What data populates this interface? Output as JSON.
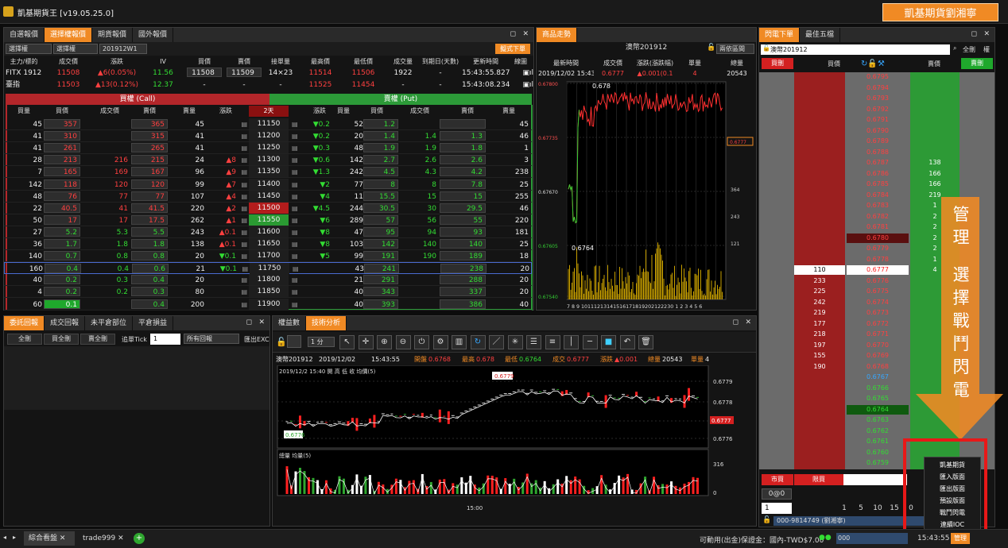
{
  "window": {
    "title": "凱基期貨王 [v19.05.25.0]",
    "brand": "凱基期貨劉湘寧"
  },
  "quote_panel": {
    "tabs": [
      "自選報價",
      "選擇權報價",
      "期貨報價",
      "國外報價"
    ],
    "selects": [
      "選擇權",
      "選擇權",
      "201912W1"
    ],
    "trad_button": "擬式下單",
    "header": [
      "主力/標的",
      "成交價",
      "漲跌",
      "IV",
      "買價",
      "賣價",
      "接單量",
      "最高價",
      "最低價",
      "成交量",
      "到期日(天數)",
      "更新時間",
      "線圖"
    ],
    "underlying": [
      [
        "FITX 1912",
        "11508",
        "▲6(0.05%)",
        "11.56",
        "11508",
        "11509",
        "14×23",
        "11514",
        "11506",
        "1922",
        "-",
        "15:43:55.827"
      ],
      [
        "臺指",
        "11503",
        "▲13(0.12%)",
        "12.37",
        "-",
        "-",
        "-",
        "11525",
        "11454",
        "-",
        "-",
        "15:43:08.234"
      ]
    ],
    "call_label": "買權 (Call)",
    "put_label": "賣權 (Put)",
    "days_label": "2天",
    "chain_header": [
      "買量",
      "買價",
      "成交價",
      "賣價",
      "賣量",
      "漲跌",
      "",
      "履約價",
      "",
      "漲跌",
      "買量",
      "買價",
      "成交價",
      "賣價",
      "賣量"
    ],
    "rows": [
      [
        "45",
        "357",
        "",
        "365",
        "45",
        "",
        "11150",
        "▼0.2",
        "52",
        "1.2",
        "",
        "",
        "45"
      ],
      [
        "41",
        "310",
        "",
        "315",
        "41",
        "",
        "11200",
        "▼0.2",
        "20",
        "1.4",
        "1.4",
        "1.3",
        "46"
      ],
      [
        "41",
        "261",
        "",
        "265",
        "41",
        "",
        "11250",
        "▼0.3",
        "48",
        "1.9",
        "1.9",
        "1.8",
        "1"
      ],
      [
        "28",
        "213",
        "216",
        "215",
        "24",
        "▲8",
        "11300",
        "▼0.6",
        "142",
        "2.7",
        "2.6",
        "2.6",
        "3"
      ],
      [
        "7",
        "165",
        "169",
        "167",
        "96",
        "▲9",
        "11350",
        "▼1.3",
        "242",
        "4.5",
        "4.3",
        "4.2",
        "238"
      ],
      [
        "142",
        "118",
        "120",
        "120",
        "99",
        "▲7",
        "11400",
        "▼2",
        "77",
        "8",
        "8",
        "7.8",
        "25"
      ],
      [
        "48",
        "76",
        "77",
        "77",
        "107",
        "▲4",
        "11450",
        "▼4",
        "11",
        "15.5",
        "15",
        "15",
        "255"
      ],
      [
        "22",
        "40.5",
        "41",
        "41.5",
        "220",
        "▲2",
        "11500",
        "▼4.5",
        "244",
        "30.5",
        "30",
        "29.5",
        "46"
      ],
      [
        "50",
        "17",
        "17",
        "17.5",
        "262",
        "▲1",
        "11550",
        "▼6",
        "289",
        "57",
        "56",
        "55",
        "220"
      ],
      [
        "27",
        "5.2",
        "5.3",
        "5.5",
        "243",
        "▲0.1",
        "11600",
        "▼8",
        "47",
        "95",
        "94",
        "93",
        "181"
      ],
      [
        "36",
        "1.7",
        "1.8",
        "1.8",
        "138",
        "▲0.1",
        "11650",
        "▼8",
        "103",
        "142",
        "140",
        "140",
        "25"
      ],
      [
        "140",
        "0.7",
        "0.8",
        "0.8",
        "20",
        "▼0.1",
        "11700",
        "▼5",
        "99",
        "191",
        "190",
        "189",
        "18"
      ],
      [
        "160",
        "0.4",
        "0.4",
        "0.6",
        "21",
        "▼0.1",
        "11750",
        "",
        "43",
        "241",
        "",
        "238",
        "20"
      ],
      [
        "40",
        "0.2",
        "0.3",
        "0.4",
        "20",
        "",
        "11800",
        "",
        "21",
        "291",
        "",
        "288",
        "20"
      ],
      [
        "4",
        "0.2",
        "0.2",
        "0.3",
        "80",
        "",
        "11850",
        "",
        "40",
        "343",
        "",
        "337",
        "20"
      ],
      [
        "60",
        "0.1",
        "",
        "0.4",
        "200",
        "",
        "11900",
        "",
        "40",
        "393",
        "",
        "386",
        "40"
      ]
    ]
  },
  "trend_panel": {
    "tab": "商品走勢",
    "symbol": "澳幣201912",
    "preset": "兩依區間",
    "header": [
      "最新時間",
      "成交價",
      "漲跌(漲跌幅)",
      "單量",
      "總量"
    ],
    "values": [
      "2019/12/02 15:43:",
      "0.6777",
      "▲0.001(0.1",
      "4",
      "20543"
    ],
    "high_label": "0.678",
    "low_label": "0.6764",
    "y_ticks": [
      "0.67800",
      "0.67735",
      "0.67670",
      "0.67605",
      "0.67540"
    ],
    "right_ticks": [
      "364",
      "243",
      "121"
    ],
    "last_tag": "0.6777",
    "x_ticks": "7 8 9 10111213141516171819202122230 1 2 3 4 5 6"
  },
  "order_panel": {
    "tabs": [
      "閃電下單",
      "最佳五檔"
    ],
    "symbol": "澳幣201912",
    "all_cancel": "全刪",
    "mode": "權",
    "buy_btn": "買刪",
    "sell_btn": "賣刪",
    "buy_header": "買價",
    "sell_header": "賣價",
    "prices": [
      "0.6795",
      "0.6794",
      "0.6793",
      "0.6792",
      "0.6791",
      "0.6790",
      "0.6789",
      "0.6788",
      "0.6787",
      "0.6786",
      "0.6785",
      "0.6784",
      "0.6783",
      "0.6782",
      "0.6781",
      "0.6780",
      "0.6779",
      "0.6778",
      "0.6777",
      "0.6776",
      "0.6775",
      "0.6774",
      "0.6773",
      "0.6772",
      "0.6771",
      "0.6770",
      "0.6769",
      "0.6768",
      "0.6767",
      "0.6766",
      "0.6765",
      "0.6764",
      "0.6763",
      "0.6762",
      "0.6761",
      "0.6760",
      "0.6759"
    ],
    "sell_qty": {
      "8": "138",
      "9": "166",
      "10": "166",
      "11": "219",
      "12": "1",
      "13": "2",
      "14": "2",
      "15": "2",
      "16": "2",
      "17": "1",
      "18": "4"
    },
    "buy_qty": {
      "18": "110",
      "19": "233",
      "20": "225",
      "21": "242",
      "22": "219",
      "23": "177",
      "24": "218",
      "25": "197",
      "26": "155",
      "27": "190"
    },
    "market_btn": "市買",
    "limit_btn": "限買",
    "pos": "0@0",
    "qty": "1",
    "qty_btns": [
      "1",
      "5",
      "10",
      "15",
      "0"
    ],
    "account": "000-9814749 (劉湘寧)"
  },
  "overlay": {
    "text": "管理選擇戰鬥閃電"
  },
  "popup_menu": {
    "items": [
      "凱基期貨",
      "匯入版面",
      "匯出版面",
      "預設版面",
      "戰鬥閃電",
      "連續IOC"
    ]
  },
  "entrust_panel": {
    "tabs": [
      "委託回報",
      "成交回報",
      "未平倉部位",
      "平倉損益"
    ],
    "buttons": [
      "全刪",
      "買全刪",
      "賣全刪"
    ],
    "tick_label": "追單Tick",
    "tick_value": "1",
    "filter": "所有回報",
    "export": "匯出EXC"
  },
  "tech_panel": {
    "tabs": [
      "權益數",
      "技術分析"
    ],
    "period": "1 分",
    "info": [
      "澳幣201912",
      "2019/12/02",
      "15:43:55",
      "開盤",
      "0.6768",
      "最高",
      "0.678",
      "最低",
      "0.6764",
      "成交",
      "0.6777",
      "漲跌",
      "▲0.001",
      "總量",
      "20543",
      "單量",
      "4"
    ],
    "candle_legend": "2019/12/2 15:40  開 高 低 收   均價(5)",
    "vol_legend": "總量   均量(5)",
    "y_ticks": [
      "0.6779",
      "0.6778",
      "0.6777",
      "0.6776"
    ],
    "vol_tick": "316",
    "vol_zero": "0",
    "time_tick": "15:00",
    "high_tag": "0.6779",
    "low_tag": "0.6776"
  },
  "statusbar": {
    "tabs": [
      "綜合看盤",
      "trade999"
    ],
    "margin": "可動用(出金)保證金：國內-TWD$7.00",
    "mini": "000",
    "time": "15:43:55",
    "manage": "管理"
  }
}
